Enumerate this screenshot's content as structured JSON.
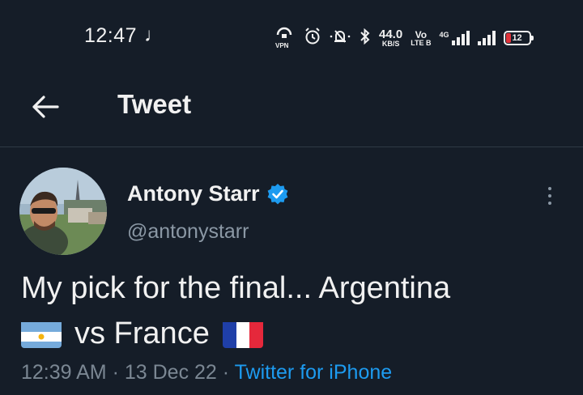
{
  "status_bar": {
    "time": "12:47",
    "music_icon": "music-note-icon",
    "vpn_label": "VPN",
    "network_speed": "44.0",
    "network_speed_unit": "KB/S",
    "volte_top": "Vo",
    "volte_bottom": "LTE B",
    "network_type": "4G",
    "battery": "12",
    "battery_color": "#e0333a"
  },
  "header": {
    "back_icon": "arrow-left-icon",
    "title": "Tweet"
  },
  "tweet": {
    "author_name": "Antony Starr",
    "verified_icon": "verified-badge-icon",
    "handle": "@antonystarr",
    "text_line1": "My pick for the final... Argentina",
    "text_line2": "vs France",
    "flag1": "argentina-flag-emoji",
    "flag2": "france-flag-emoji",
    "time": "12:39 AM",
    "separator": "·",
    "date": "13 Dec 22",
    "source": "Twitter for iPhone",
    "more_icon": "more-vertical-icon"
  },
  "colors": {
    "background": "#151d28",
    "text_primary": "#f1f1f1",
    "text_secondary": "#8b98a5",
    "accent": "#1d9bf0"
  }
}
